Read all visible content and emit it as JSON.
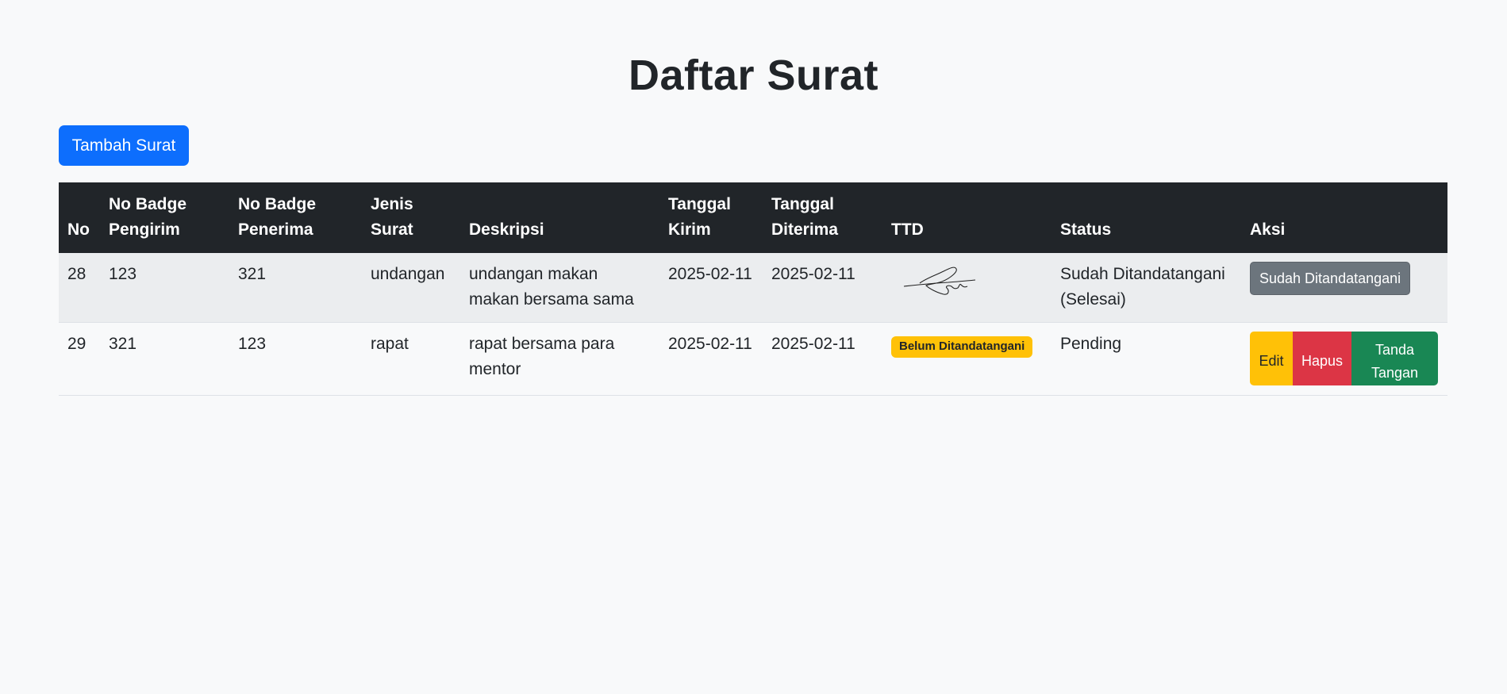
{
  "page": {
    "title": "Daftar Surat",
    "add_button": "Tambah Surat"
  },
  "table": {
    "headers": {
      "no": "No",
      "sender_line1": "No Badge",
      "sender_line2": "Pengirim",
      "receiver_line1": "No Badge",
      "receiver_line2": "Penerima",
      "type_line1": "Jenis",
      "type_line2": "Surat",
      "description": "Deskripsi",
      "sent_line1": "Tanggal",
      "sent_line2": "Kirim",
      "received_line1": "Tanggal",
      "received_line2": "Diterima",
      "signature": "TTD",
      "status": "Status",
      "actions": "Aksi"
    },
    "rows": [
      {
        "no": "28",
        "sender": "123",
        "receiver": "321",
        "type": "undangan",
        "description": "undangan makan makan bersama sama",
        "date_sent": "2025-02-11",
        "date_received": "2025-02-11",
        "status": "Sudah Ditandatangani (Selesai)",
        "action_label": "Sudah Ditandatangani"
      },
      {
        "no": "29",
        "sender": "321",
        "receiver": "123",
        "type": "rapat",
        "description": "rapat bersama para mentor",
        "date_sent": "2025-02-11",
        "date_received": "2025-02-11",
        "signature_badge": "Belum Ditandatangani",
        "status": "Pending",
        "actions": {
          "edit": "Edit",
          "delete": "Hapus",
          "sign": "Tanda Tangan"
        }
      }
    ]
  },
  "colors": {
    "primary": "#0d6efd",
    "dark_header": "#212529",
    "warning": "#ffc107",
    "danger": "#dc3545",
    "success": "#198754",
    "secondary": "#6c757d"
  }
}
